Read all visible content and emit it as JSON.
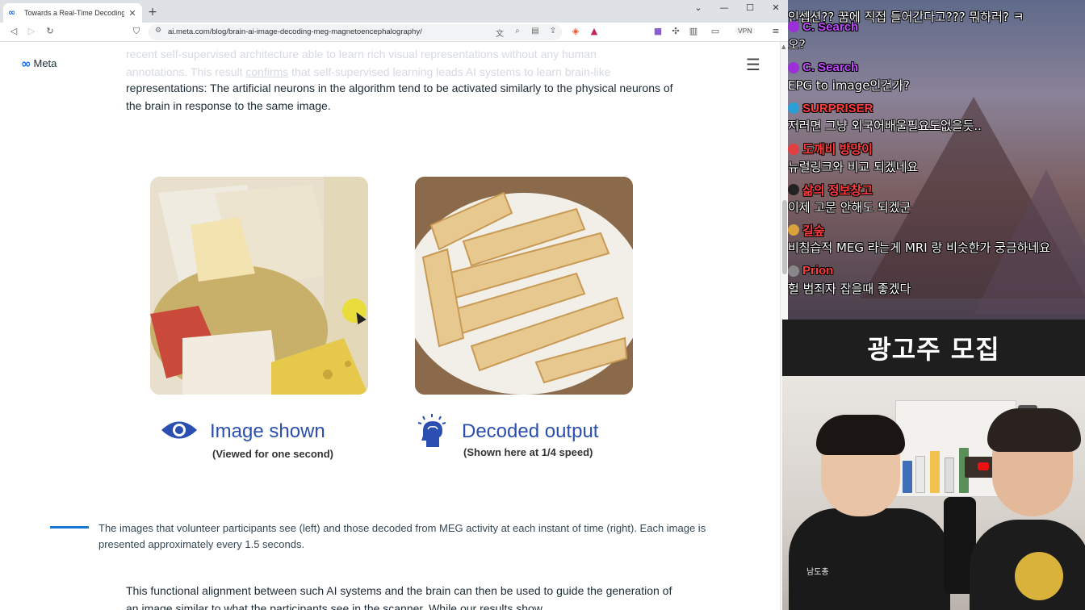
{
  "browser": {
    "tab_title": "Towards a Real-Time Decoding o",
    "tab_favicon": "meta-infinity-icon",
    "url": "ai.meta.com/blog/brain-ai-image-decoding-meg-magnetoencephalography/",
    "vpn_label": "VPN"
  },
  "page": {
    "logo_text": "Meta",
    "faded_line1": "recent self-supervised architecture able to learn rich visual representations without any human",
    "faded_line2_a": "annotations. This result ",
    "faded_line2_link": "confirms",
    "faded_line2_b": " that self-supervised learning leads AI systems to learn brain-like",
    "paragraph": "representations: The artificial neurons in the algorithm tend to be activated similarly to the physical neurons of the brain in response to the same image.",
    "figure_left_title": "Image shown",
    "figure_left_sub": "(Viewed for one second)",
    "figure_right_title": "Decoded output",
    "figure_right_sub": "(Shown here at 1/4 speed)",
    "caption": "The images that volunteer participants see (left) and those decoded from MEG activity at each instant of time (right). Each image is presented approximately every 1.5 seconds.",
    "lower_paragraph": "This functional alignment between such AI systems and the brain can then be used to guide the generation of an image similar to what the participants see in the scanner. While our results show"
  },
  "chat": {
    "messages": [
      {
        "user": "",
        "text": "인셉션?? 꿈에 직접 들어간다고??? 뭐하러? ㅋ",
        "color": "#ff5a5a",
        "badge": "#c33"
      },
      {
        "user": "C. Search",
        "text": "오?",
        "color": "#c04bff",
        "badge": "#9b30d9"
      },
      {
        "user": "C. Search",
        "text": "EPG to image인건가?",
        "color": "#c04bff",
        "badge": "#9b30d9"
      },
      {
        "user": "SURPRISER",
        "text": "저러면 그냥 외국어배울필요도없을듯..",
        "color": "#ff3b3b",
        "badge": "#2a9fd6"
      },
      {
        "user": "도깨비 방망이",
        "text": "뉴럴링크와 비교 되겠네요",
        "color": "#ff3b3b",
        "badge": "#e04040"
      },
      {
        "user": "삶의 정보창고",
        "text": "이제 고문 안해도 되겠군",
        "color": "#ff3b3b",
        "badge": "#222"
      },
      {
        "user": "길숲",
        "text": "비침습적 MEG 라는게 MRI 랑 비슷한가 궁금하네요",
        "color": "#ff3b3b",
        "badge": "#d9a23a"
      },
      {
        "user": "Prion",
        "text": "헐 범죄자 잡을때 좋겠다",
        "color": "#ff3b3b",
        "badge": "#888"
      }
    ]
  },
  "ad_banner": "광고주 모집",
  "webcam_tag": "남도총"
}
